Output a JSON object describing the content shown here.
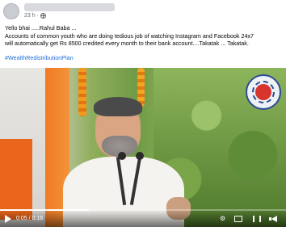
{
  "post": {
    "timestamp": "23 h",
    "privacy_icon": "globe-icon",
    "lines": [
      "Yello bhai .....Rahul Baba ...",
      "Accounts of common youth who are doing tedious job of watching Instagram and Facebook 24x7",
      "will automatically get Rs 8500 credited every month to their bank account....Takatak ... Takatak."
    ],
    "hashtag": "#WealthRedistributionPlan"
  },
  "video": {
    "watermark_text": "VIBES OF BHARAT",
    "current_time": "0:05",
    "duration": "0:16",
    "time_display": "0:05 / 0:16",
    "progress": 0.31,
    "controls": {
      "play_icon": "play-icon",
      "settings_icon": "gear-icon",
      "pip_icon": "picture-in-picture-icon",
      "fullscreen_icon": "fullscreen-icon",
      "volume_icon": "volume-icon"
    }
  }
}
